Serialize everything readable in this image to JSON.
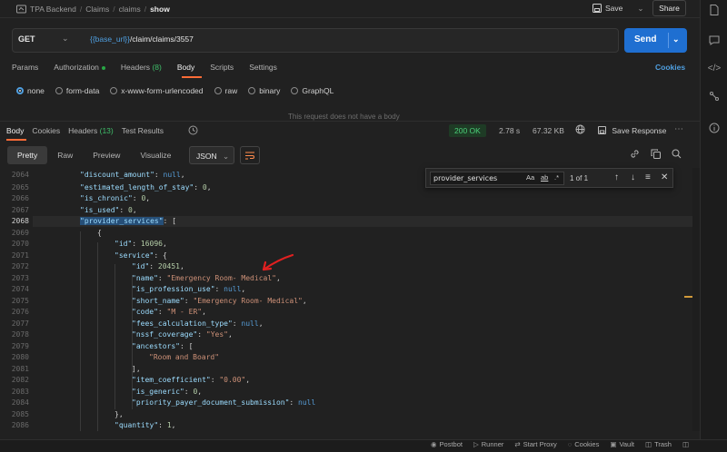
{
  "breadcrumb": {
    "items": [
      "TPA Backend",
      "Claims",
      "claims"
    ],
    "current": "show"
  },
  "header": {
    "save_label": "Save",
    "share_label": "Share"
  },
  "request": {
    "method": "GET",
    "url_variable": "{{base_url}}",
    "url_path": "/claim/claims/3557",
    "send_label": "Send",
    "tabs": {
      "params": "Params",
      "authorization": "Authorization",
      "headers": "Headers",
      "headers_count": "(8)",
      "body": "Body",
      "scripts": "Scripts",
      "settings": "Settings"
    },
    "cookies_label": "Cookies",
    "body_types": [
      "none",
      "form-data",
      "x-www-form-urlencoded",
      "raw",
      "binary",
      "GraphQL"
    ],
    "selected_body_type": "none",
    "no_body_text": "This request does not have a body"
  },
  "response": {
    "tabs": {
      "body": "Body",
      "cookies": "Cookies",
      "headers": "Headers",
      "headers_count": "(13)",
      "test_results": "Test Results"
    },
    "status": "200 OK",
    "time": "2.78 s",
    "size": "67.32 KB",
    "save_response_label": "Save Response",
    "view_modes": [
      "Pretty",
      "Raw",
      "Preview",
      "Visualize"
    ],
    "selected_view": "Pretty",
    "format": "JSON"
  },
  "find": {
    "query": "provider_services",
    "count": "1 of 1",
    "opt_case": "Aa",
    "opt_word": "ab",
    "opt_regex": ".*"
  },
  "code_lines": {
    "n2064": "2064",
    "n2065": "2065",
    "n2066": "2066",
    "n2067": "2067",
    "n2068": "2068",
    "n2069": "2069",
    "n2070": "2070",
    "n2071": "2071",
    "n2072": "2072",
    "n2073": "2073",
    "n2074": "2074",
    "n2075": "2075",
    "n2076": "2076",
    "n2077": "2077",
    "n2078": "2078",
    "n2079": "2079",
    "n2080": "2080",
    "n2081": "2081",
    "n2082": "2082",
    "n2083": "2083",
    "n2084": "2084",
    "n2085": "2085",
    "n2086": "2086",
    "k_discount_amount": "\"discount_amount\"",
    "v_null": "null",
    "k_estimated_length_of_stay": "\"estimated_length_of_stay\"",
    "v_0": "0",
    "k_is_chronic": "\"is_chronic\"",
    "k_is_used": "\"is_used\"",
    "k_provider_services": "\"provider_services\"",
    "k_id": "\"id\"",
    "v_16096": "16096",
    "k_service": "\"service\"",
    "v_20451": "20451",
    "k_name": "\"name\"",
    "v_name": "\"Emergency Room- Medical\"",
    "k_is_profession_use": "\"is_profession_use\"",
    "k_short_name": "\"short_name\"",
    "v_short_name": "\"Emergency Room- Medical\"",
    "k_code": "\"code\"",
    "v_code": "\"M - ER\"",
    "k_fees_calculation_type": "\"fees_calculation_type\"",
    "k_nssf_coverage": "\"nssf_coverage\"",
    "v_nssf_coverage": "\"Yes\"",
    "k_ancestors": "\"ancestors\"",
    "v_room_and_board": "\"Room and Board\"",
    "k_item_coefficient": "\"item_coefficient\"",
    "v_item_coefficient": "\"0.00\"",
    "k_is_generic": "\"is_generic\"",
    "k_priority": "\"priority_payer_document_submission\"",
    "k_quantity": "\"quantity\"",
    "v_1": "1"
  },
  "footer": {
    "postbot": "Postbot",
    "runner": "Runner",
    "start_proxy": "Start Proxy",
    "cookies": "Cookies",
    "vault": "Vault",
    "trash": "Trash"
  },
  "colors": {
    "accent": "#ff6c37",
    "send": "#1f6fd1",
    "status_ok": "#4cd07a",
    "annotation_arrow": "#e02020"
  }
}
